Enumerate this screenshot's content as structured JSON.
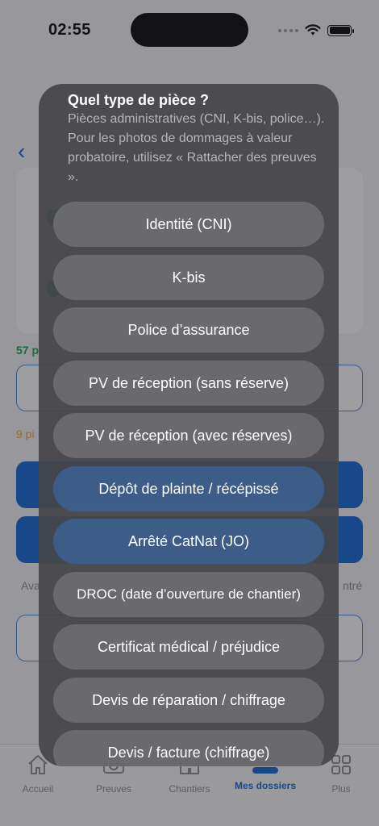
{
  "status_bar": {
    "time": "02:55"
  },
  "background": {
    "green_count_text": "57 p",
    "orange_count_text": "9 pi",
    "muted_left_text": "Ava",
    "muted_right_text": "ntré"
  },
  "sheet": {
    "title": "Quel type de pièce ?",
    "message": "Pièces administratives (CNI, K-bis, police…). Pour les photos de dommages à valeur probatoire, utilisez « Rattacher des preuves ».",
    "options": [
      {
        "label": "Identité (CNI)"
      },
      {
        "label": "K-bis"
      },
      {
        "label": "Police d’assurance"
      },
      {
        "label": "PV de réception (sans réserve)"
      },
      {
        "label": "PV de réception (avec réserves)"
      },
      {
        "label": "Dépôt de plainte / récépissé"
      },
      {
        "label": "Arrêté CatNat (JO)"
      },
      {
        "label": "DROC (date d’ouverture de chantier)"
      },
      {
        "label": "Certificat médical / préjudice"
      },
      {
        "label": "Devis de réparation / chiffrage"
      },
      {
        "label": "Devis / facture (chiffrage)"
      }
    ]
  },
  "tabbar": {
    "tabs": [
      {
        "label": "Accueil",
        "icon": "home-icon"
      },
      {
        "label": "Preuves",
        "icon": "camera-icon"
      },
      {
        "label": "Chantiers",
        "icon": "building-icon"
      },
      {
        "label": "Mes dossiers",
        "icon": "folder-icon",
        "active": true
      },
      {
        "label": "Plus",
        "icon": "grid-icon"
      }
    ]
  },
  "colors": {
    "accent": "#0a64d8",
    "success": "#1f9d4f",
    "warning": "#e8a52c"
  }
}
